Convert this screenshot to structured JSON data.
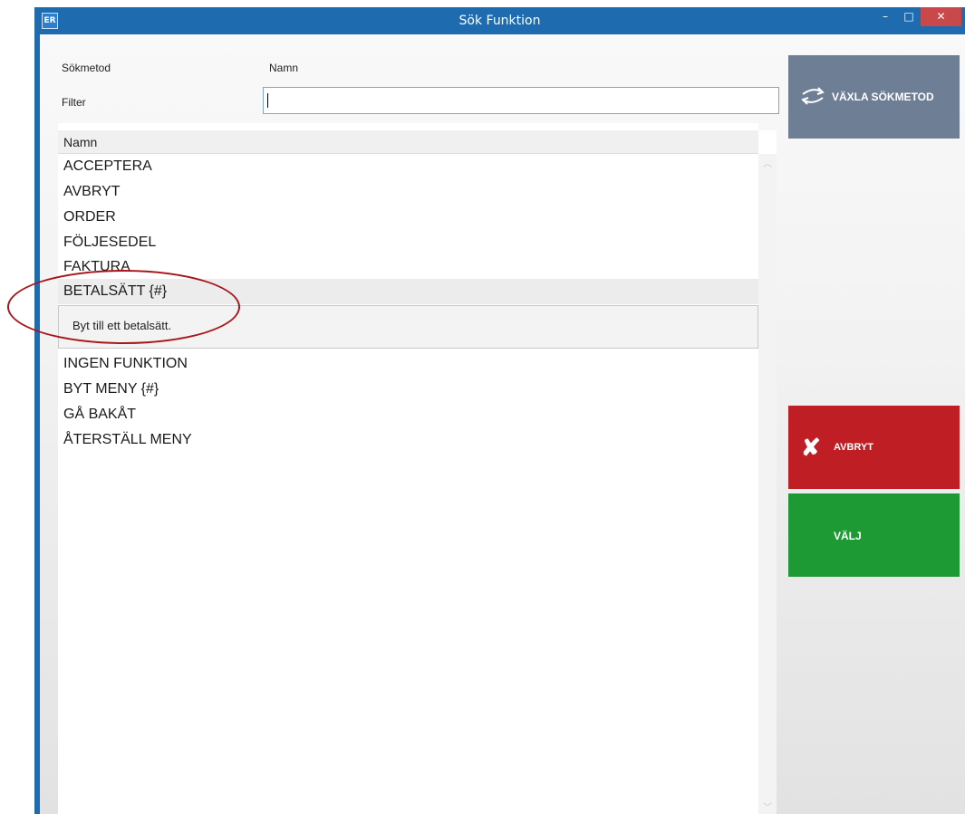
{
  "window": {
    "app_icon_text": "ER",
    "title": "Sök Funktion",
    "minimize_label": "–",
    "maximize_label": "□",
    "close_label": "✕"
  },
  "form": {
    "method_label": "Sökmetod",
    "method_value": "Namn",
    "filter_label": "Filter",
    "filter_value": ""
  },
  "grid": {
    "column_header": "Namn",
    "rows": [
      "ACCEPTERA",
      "AVBRYT",
      "ORDER",
      "FÖLJESEDEL",
      "FAKTURA",
      "BETALSÄTT {#}",
      "INGEN FUNKTION",
      "BYT MENY {#}",
      "GÅ BAKÅT",
      "ÅTERSTÄLL MENY"
    ],
    "selected_index": 5,
    "selected_details": "Byt till ett betalsätt."
  },
  "buttons": {
    "switch_label": "VÄXLA SÖKMETOD",
    "cancel_label": "AVBRYT",
    "choose_label": "VÄLJ"
  },
  "colors": {
    "titlebar": "#1e6bb0",
    "switch_button": "#6e7f95",
    "cancel_button": "#be1e24",
    "choose_button": "#1e9a34",
    "annotation": "#a8161a"
  }
}
